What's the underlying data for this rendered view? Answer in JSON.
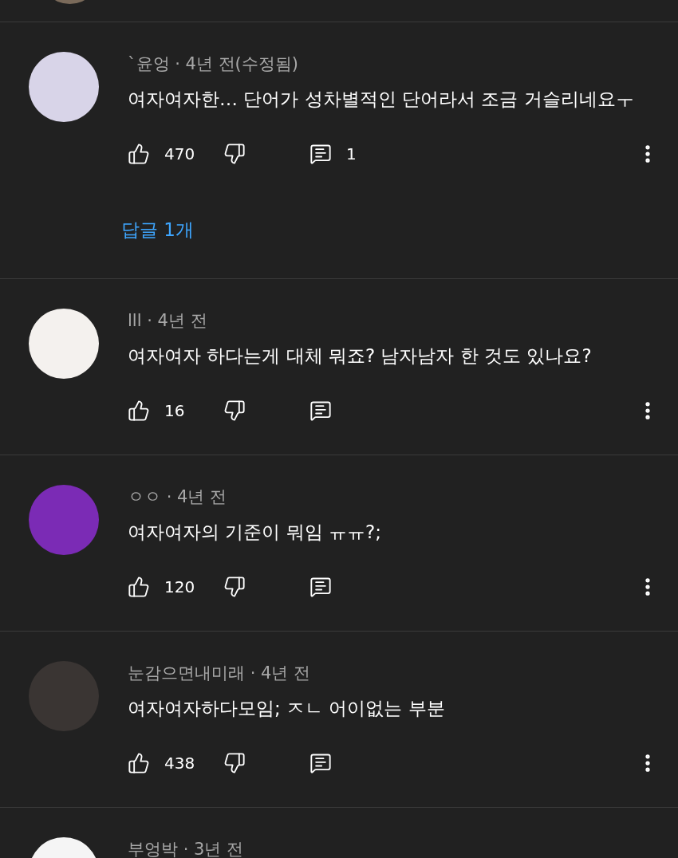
{
  "comments": [
    {
      "color": "#d8d4e8",
      "header": "`윤엉 · 4년 전(수정됨)",
      "text": "여자여자한… 단어가 성차별적인 단어라서 조금 거슬리네요ㅜ",
      "likes": "470",
      "reply_count": "1",
      "replies_link": "답글 1개"
    },
    {
      "color": "#f4f1ee",
      "header": "lll · 4년 전",
      "text": "여자여자 하다는게 대체 뭐죠? 남자남자 한 것도 있나요?",
      "likes": "16"
    },
    {
      "color": "#7b2bb5",
      "header": "ㅇㅇ · 4년 전",
      "text": "여자여자의 기준이 뭐임 ㅠㅠ?;",
      "likes": "120"
    },
    {
      "color": "#3a3533",
      "header": "눈감으면내미래 · 4년 전",
      "text": "여자여자하다모임; ㅈㄴ 어이없는 부분",
      "likes": "438"
    },
    {
      "color": "#f5f5f5",
      "header": "부엉박 · 3년 전"
    }
  ]
}
